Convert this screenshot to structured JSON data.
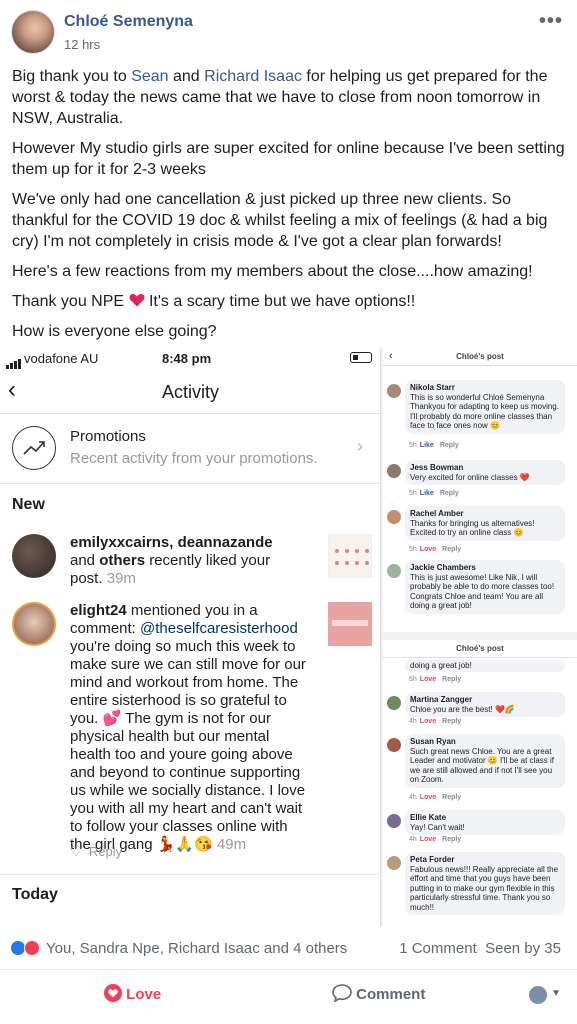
{
  "post": {
    "author": "Chloé Semenyna",
    "time": "12 hrs"
  },
  "body": {
    "p1_a": "Big thank you to ",
    "p1_link1": "Sean",
    "p1_b": " and ",
    "p1_link2": "Richard Isaac",
    "p1_c": " for helping us get prepared for the worst & today the news came that we have to close from noon tomorrow in NSW, Australia.",
    "p2": "However My studio girls are super excited for online because I've been setting them up for it for 2-3 weeks",
    "p3": "We've only had one cancellation & just picked up three new clients. So thankful for the COVID 19 doc & whilst feeling a mix of feelings (& had a big cry) I'm not completely in crisis mode & I've got a clear plan forwards!",
    "p4": "Here's a few reactions from my members about the close....how amazing!",
    "p5_a": "Thank you NPE",
    "p5_b": " It's a scary time but we have options!!",
    "p6": "How is everyone else going?"
  },
  "ig": {
    "carrier": "vodafone AU",
    "clock": "8:48 pm",
    "title": "Activity",
    "promo_title": "Promotions",
    "promo_sub": "Recent activity from your promotions.",
    "new_label": "New",
    "today_label": "Today",
    "item1_names": "emilyxxcairns, deannazande",
    "item1_and": " and ",
    "item1_others": "others",
    "item1_rest": " recently liked your post.",
    "item1_time": " 39m",
    "item2_user": "elight24",
    "item2_text": " mentioned you in a comment: ",
    "item2_handle": "@theselfcaresisterhood",
    "item2_body": " you're doing so much this week to make sure we can still move for our mind and workout from home. The entire sisterhood is so grateful to you. 💕 The gym is not for our physical health but our mental health too and youre going above and beyond to continue supporting us while we socially distance. I love you with all my heart and can't wait to follow your classes online with the girl gang 💃🙏😘",
    "item2_time": " 49m",
    "reply": "Reply"
  },
  "fb1": {
    "title": "Chloé's post",
    "comments": [
      {
        "name": "Nikola Starr",
        "text": "This is so wonderful Chloé Semenyna Thankyou for adapting to keep us moving. I'll probably do more online classes than face to face ones now 😊",
        "meta": "5h",
        "action": "Like"
      },
      {
        "name": "Jess Bowman",
        "text": "Very excited for online classes ❤️",
        "meta": "5h",
        "action": "Like"
      },
      {
        "name": "Rachel Amber",
        "text": "Thanks for bringing us alternatives! Excited to try an online class 😊",
        "meta": "5h",
        "action": "Love"
      },
      {
        "name": "Jackie Chambers",
        "text": "This is just awesome! Like Nik, I will probably be able to do more classes too! Congrats Chloe and team! You are all doing a great job!",
        "meta": "5h",
        "action": "Love"
      }
    ]
  },
  "fb2": {
    "title": "Chloé's post",
    "top_text": "doing a great job!",
    "top_meta": "5h",
    "top_action": "Love",
    "comments": [
      {
        "name": "Martina Zangger",
        "text": "Chloe you are the best! ❤️🌈",
        "meta": "4h",
        "action": "Love"
      },
      {
        "name": "Susan Ryan",
        "text": "Such great news Chloe. You are a great Leader and motivator 😊 I'll be at class if we are still allowed and if not I'll see you on Zoom.",
        "meta": "4h",
        "action": "Love"
      },
      {
        "name": "Ellie Kate",
        "text": "Yay! Can't wait!",
        "meta": "4h",
        "action": "Love"
      },
      {
        "name": "Peta Forder",
        "text": "Fabulous news!!! Really appreciate all the effort and time that you guys have been putting in to make our gym flexible in this particularly stressful time. Thank you so much!!",
        "meta": "",
        "action": ""
      }
    ]
  },
  "reply_label": "Reply",
  "stats": {
    "names": "You, Sandra Npe, Richard Isaac and 4 others",
    "comments": "1 Comment",
    "seen": "Seen by 35"
  },
  "actions": {
    "love": "Love",
    "comment": "Comment"
  },
  "colors": {
    "link": "#365899",
    "love": "#f33e58",
    "like": "#2078f4"
  }
}
